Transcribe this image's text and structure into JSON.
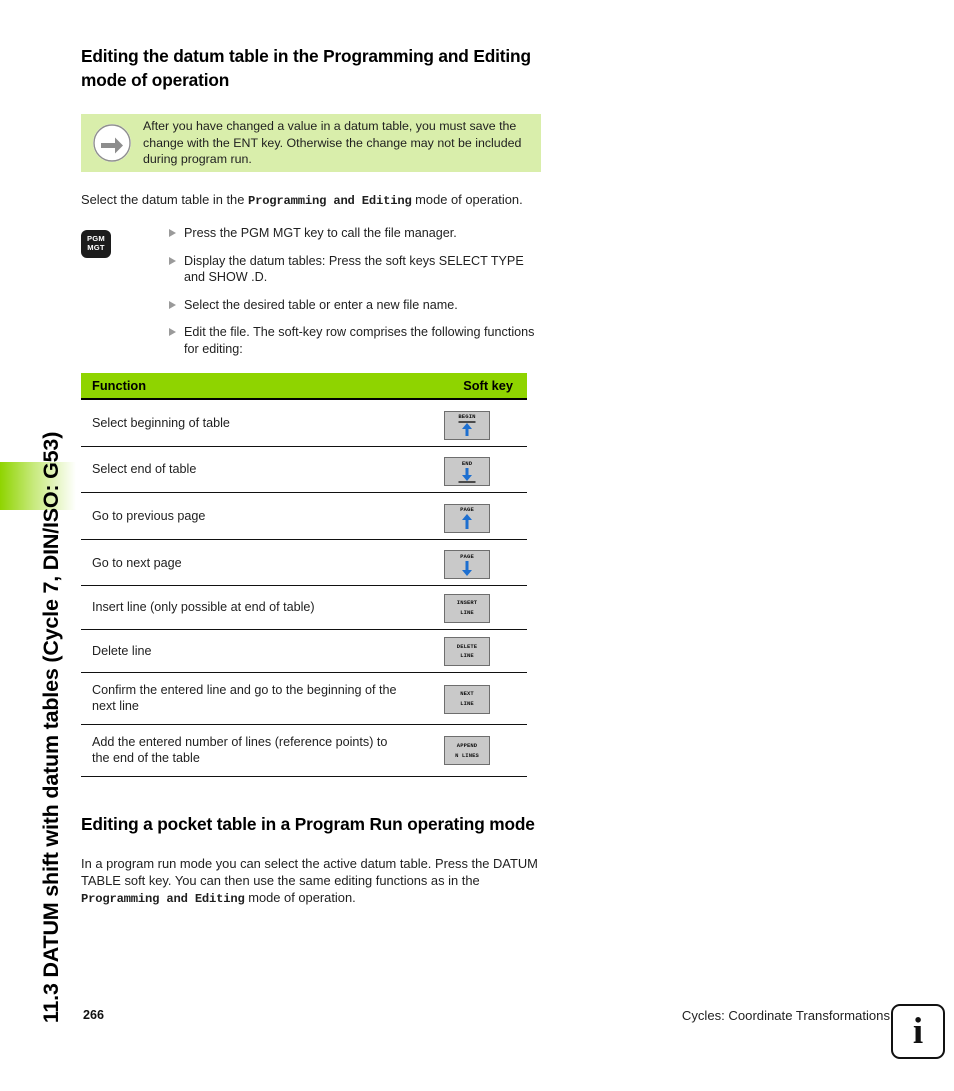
{
  "sidebar": {
    "chapter_title": "11.3 DATUM shift with datum tables (Cycle 7, DIN/ISO: G53)",
    "tab_color": "#8fd400"
  },
  "main": {
    "heading_1": "Editing the datum table in the Programming and Editing mode of operation",
    "note": {
      "icon": "circle-arrow-icon",
      "text": "After you have changed a value in a datum table, you must save the change with the ENT key. Otherwise the change may not be included during program run.",
      "background_color": "#d9eeab"
    },
    "intro": {
      "part1": "Select the datum table in the ",
      "emphasis": "Programming and Editing",
      "part2": " mode of operation."
    },
    "pgm_key": {
      "line1": "PGM",
      "line2": "MGT"
    },
    "steps": [
      "Press the PGM MGT key to call the file manager.",
      "Display the datum tables: Press the soft keys SELECT TYPE and SHOW .D.",
      "Select the desired table or enter a new file name.",
      "Edit the file. The soft-key row comprises the following functions for editing:"
    ],
    "table": {
      "header_color": "#8fd400",
      "columns": [
        "Function",
        "Soft key"
      ],
      "rows": [
        {
          "function": "Select beginning of table",
          "softkey": {
            "name": "begin-softkey",
            "label_lines": [
              "BEGIN"
            ],
            "glyph": "arrow-up-to-bar"
          }
        },
        {
          "function": "Select end of table",
          "softkey": {
            "name": "end-softkey",
            "label_lines": [
              "END"
            ],
            "glyph": "arrow-down-to-bar"
          }
        },
        {
          "function": "Go to previous page",
          "softkey": {
            "name": "page-up-softkey",
            "label_lines": [
              "PAGE"
            ],
            "glyph": "arrow-up"
          }
        },
        {
          "function": "Go to next page",
          "softkey": {
            "name": "page-down-softkey",
            "label_lines": [
              "PAGE"
            ],
            "glyph": "arrow-down"
          }
        },
        {
          "function": "Insert line (only possible at end of table)",
          "softkey": {
            "name": "insert-line-softkey",
            "label_lines": [
              "INSERT",
              "LINE"
            ],
            "glyph": "none"
          }
        },
        {
          "function": "Delete line",
          "softkey": {
            "name": "delete-line-softkey",
            "label_lines": [
              "DELETE",
              "LINE"
            ],
            "glyph": "none"
          }
        },
        {
          "function": "Confirm the entered line and go to the beginning of the next line",
          "softkey": {
            "name": "next-line-softkey",
            "label_lines": [
              "NEXT",
              "LINE"
            ],
            "glyph": "none"
          }
        },
        {
          "function": "Add the entered number of lines (reference points) to the end of the table",
          "softkey": {
            "name": "append-n-lines-softkey",
            "label_lines": [
              "APPEND",
              "N LINES"
            ],
            "glyph": "none"
          }
        }
      ]
    },
    "heading_2": "Editing a pocket table in a Program Run operating mode",
    "outro": {
      "part1": "In a program run mode you can select the active datum table. Press the DATUM TABLE soft key. You can then use the same editing functions as in the ",
      "emphasis": "Programming and Editing",
      "part2": " mode of operation."
    }
  },
  "footer": {
    "page_number": "266",
    "chapter": "Cycles: Coordinate Transformations",
    "info_badge": "i"
  }
}
